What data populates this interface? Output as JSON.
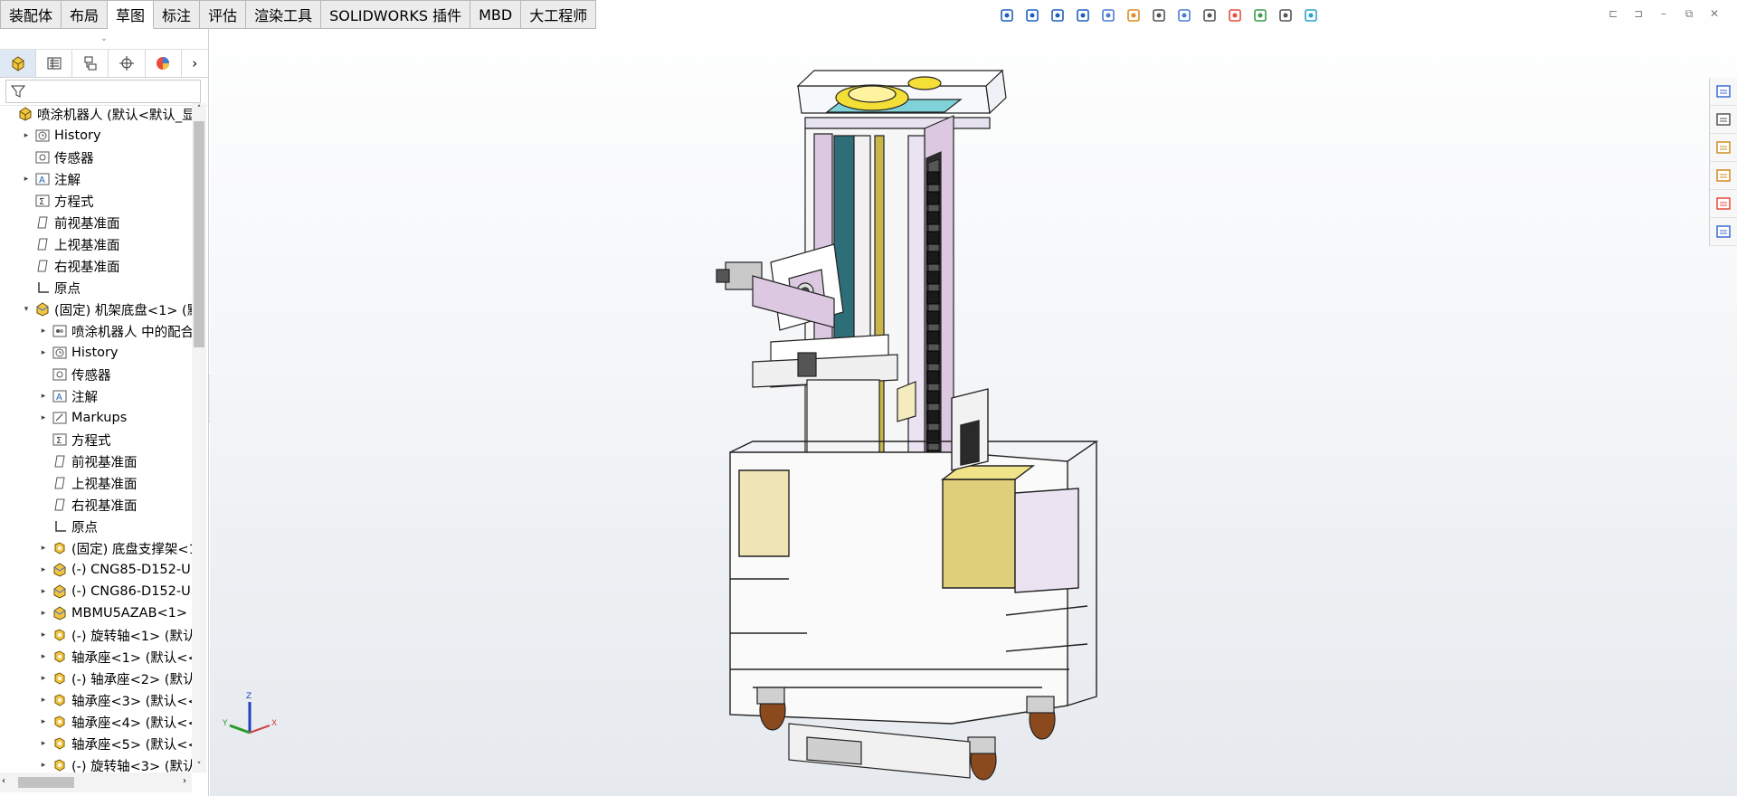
{
  "tabs": [
    "装配体",
    "布局",
    "草图",
    "标注",
    "评估",
    "渲染工具",
    "SOLIDWORKS 插件",
    "MBD",
    "大工程师"
  ],
  "active_tab": "草图",
  "panel": {
    "grip": "⌄",
    "tab_icons": [
      "feature-manager-icon",
      "property-manager-icon",
      "configuration-manager-icon",
      "dimxpert-icon",
      "display-manager-icon"
    ],
    "more": "›",
    "filter_icon": "filter-icon"
  },
  "tree": [
    {
      "label": "喷涂机器人  (默认<默认_显",
      "icon": "assembly-icon",
      "exp": "",
      "indent": 0
    },
    {
      "label": "History",
      "icon": "history-icon",
      "exp": "▸",
      "indent": 1
    },
    {
      "label": "传感器",
      "icon": "sensor-icon",
      "exp": "",
      "indent": 1
    },
    {
      "label": "注解",
      "icon": "annotation-icon",
      "exp": "▸",
      "indent": 1
    },
    {
      "label": "方程式",
      "icon": "equation-icon",
      "exp": "",
      "indent": 1
    },
    {
      "label": "前视基准面",
      "icon": "plane-icon",
      "exp": "",
      "indent": 1
    },
    {
      "label": "上视基准面",
      "icon": "plane-icon",
      "exp": "",
      "indent": 1
    },
    {
      "label": "右视基准面",
      "icon": "plane-icon",
      "exp": "",
      "indent": 1
    },
    {
      "label": "原点",
      "icon": "origin-icon",
      "exp": "",
      "indent": 1
    },
    {
      "label": "(固定) 机架底盘<1> (默",
      "icon": "subassembly-icon",
      "exp": "▾",
      "indent": 1
    },
    {
      "label": "喷涂机器人 中的配合",
      "icon": "mates-icon",
      "exp": "▸",
      "indent": 2
    },
    {
      "label": "History",
      "icon": "history-icon",
      "exp": "▸",
      "indent": 2
    },
    {
      "label": "传感器",
      "icon": "sensor-icon",
      "exp": "",
      "indent": 2
    },
    {
      "label": "注解",
      "icon": "annotation-icon",
      "exp": "▸",
      "indent": 2
    },
    {
      "label": "Markups",
      "icon": "markups-icon",
      "exp": "▸",
      "indent": 2
    },
    {
      "label": "方程式",
      "icon": "equation-icon",
      "exp": "",
      "indent": 2
    },
    {
      "label": "前视基准面",
      "icon": "plane-icon",
      "exp": "",
      "indent": 2
    },
    {
      "label": "上视基准面",
      "icon": "plane-icon",
      "exp": "",
      "indent": 2
    },
    {
      "label": "右视基准面",
      "icon": "plane-icon",
      "exp": "",
      "indent": 2
    },
    {
      "label": "原点",
      "icon": "origin-icon",
      "exp": "",
      "indent": 2
    },
    {
      "label": "(固定) 底盘支撑架<1",
      "icon": "part-icon",
      "exp": "▸",
      "indent": 2
    },
    {
      "label": "(-) CNG85-D152-U",
      "icon": "subassembly-icon",
      "exp": "▸",
      "indent": 2
    },
    {
      "label": "(-) CNG86-D152-U",
      "icon": "subassembly-icon",
      "exp": "▸",
      "indent": 2
    },
    {
      "label": "MBMU5AZAB<1>",
      "icon": "subassembly-icon",
      "exp": "▸",
      "indent": 2
    },
    {
      "label": "(-) 旋转轴<1> (默认",
      "icon": "part-icon",
      "exp": "▸",
      "indent": 2
    },
    {
      "label": "轴承座<1> (默认<<",
      "icon": "part-icon",
      "exp": "▸",
      "indent": 2
    },
    {
      "label": "(-) 轴承座<2> (默认",
      "icon": "part-icon",
      "exp": "▸",
      "indent": 2
    },
    {
      "label": "轴承座<3> (默认<<",
      "icon": "part-icon",
      "exp": "▸",
      "indent": 2
    },
    {
      "label": "轴承座<4> (默认<<",
      "icon": "part-icon",
      "exp": "▸",
      "indent": 2
    },
    {
      "label": "轴承座<5> (默认<<",
      "icon": "part-icon",
      "exp": "▸",
      "indent": 2
    },
    {
      "label": "(-) 旋转轴<3> (默认",
      "icon": "part-icon",
      "exp": "▸",
      "indent": 2
    }
  ],
  "heads_up_icons": [
    "view-orientation-icon",
    "zoom-to-fit-icon",
    "zoom-area-icon",
    "previous-view-icon",
    "section-view-icon",
    "dynamic-annotation-icon",
    "view-orientation-dropdown-icon",
    "display-style-icon",
    "hide-show-icon",
    "edit-appearance-icon",
    "apply-scene-icon",
    "view-settings-icon",
    "display-pane-icon"
  ],
  "window_controls": [
    "⊏",
    "⊐",
    "–",
    "⧉",
    "✕"
  ],
  "task_pane_icons": [
    "home-icon",
    "design-library-icon",
    "file-explorer-icon",
    "view-palette-icon",
    "appearances-icon",
    "custom-properties-icon"
  ],
  "triad": {
    "z": "Z",
    "y": "Y",
    "x": "X"
  },
  "colors": {
    "accent": "#1f5fbf",
    "tab_active": "#ffffff",
    "model_lilac": "#dcc8e0",
    "model_gold": "#e0cf7a",
    "model_teal": "#2d6e78"
  }
}
